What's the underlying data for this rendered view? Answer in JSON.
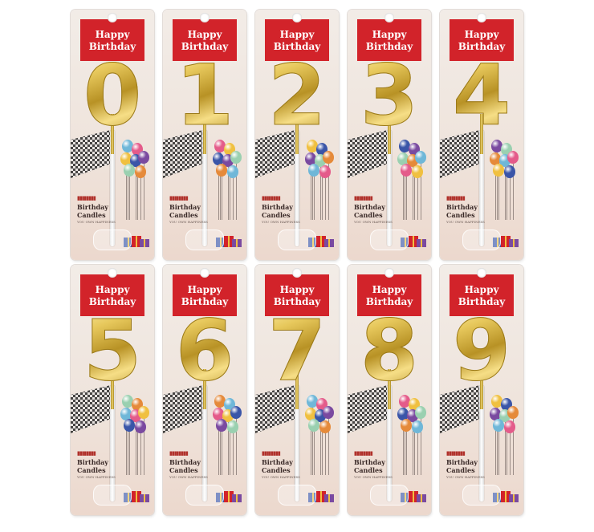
{
  "banner": {
    "line1": "Happy",
    "line2": "Birthday"
  },
  "label": {
    "title": "Birthday Candles",
    "tagline": "YOU OWN HAPPINESS"
  },
  "candles": [
    {
      "digit": "0"
    },
    {
      "digit": "1"
    },
    {
      "digit": "2"
    },
    {
      "digit": "3"
    },
    {
      "digit": "4"
    },
    {
      "digit": "5"
    },
    {
      "digit": "6"
    },
    {
      "digit": "7"
    },
    {
      "digit": "8"
    },
    {
      "digit": "9"
    }
  ],
  "colors": {
    "banner_red": "#d2232a",
    "gold": "#d4b24a",
    "card_bg": "#efe4dc"
  }
}
